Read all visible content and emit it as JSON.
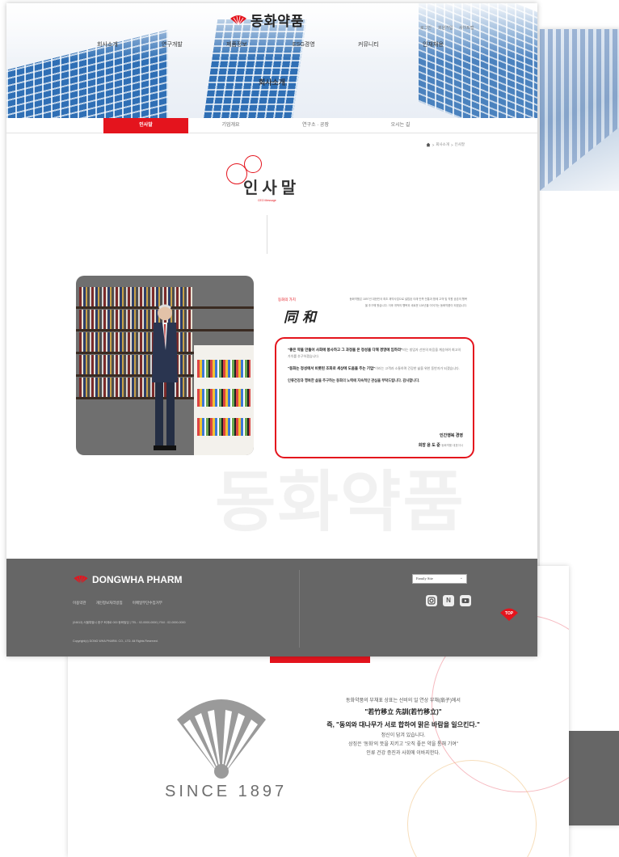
{
  "brand": {
    "name_kr": "동화약품",
    "name_en": "DONGWHA PHARM",
    "accent_color": "#e4141d",
    "footer_color": "#666666"
  },
  "header": {
    "util_links": [
      "로그인",
      "회원가입",
      "사이트맵"
    ],
    "gnb": [
      "회사소개",
      "연구개발",
      "제품정보",
      "ESG경영",
      "커뮤니티",
      "인재채용"
    ],
    "hero_title": "회사소개"
  },
  "subnav": {
    "items": [
      "인사말",
      "기업개요",
      "연구소 · 공장",
      "오시는 길"
    ],
    "active_index": 0
  },
  "breadcrumb": [
    "회사소개",
    "인사말"
  ],
  "page": {
    "title": "인사말",
    "subtitle": "CEO Message"
  },
  "motto": {
    "small_label": "동화의 가치",
    "hanja": "同和",
    "intro": "동화약품은 1897년 대한민국 최초 제약사업으로 설립된 이래 민족 전통과 함께 고객 및 직원 공존의 행복을 추구해 왔습니다. 이후 개척의 행복과 새로운 126년을 이어가는 동화약품이 되겠습니다."
  },
  "message": {
    "p1_bold": "\"좋은 약을 만들어 사회에 봉사하고 그 과정을 온 정성을 다해 경영에 임하라\"",
    "p1_rest": "라는 창업자 선친의 마음을 계승하여 최고의 가치를 추구하겠습니다.",
    "p2_bold": "\"동화는 정성에서 비롯된 조화로 세상에 도움을 주는 기업\"",
    "p2_rest": "이라는 고객과 소통하며 건강한 삶을 위한 동반자가 되겠습니다.",
    "p3": "인류건강과 행복한 삶을 추구하는 동화의 노력에 지속적인 관심을 부탁드립니다. 감사합니다.",
    "sign_line1": "인간행복 경영",
    "sign_name": "회장 윤 도 준",
    "sign_note": "동화약품 대표이사"
  },
  "watermark": "동화약품",
  "footer": {
    "links": [
      "이용약관",
      "개인정보처리방침",
      "이메일무단수집거부"
    ],
    "address": "(04613) 서울특별시 중구 퇴계로 000 동화빌딩 | TEL : 02-0000-0000 | FAX : 02-0000-0000",
    "copyright": "Copyright(c) DONG WHA PHARM. CO., LTD. All Rights Reserved.",
    "family_site": "Family Site",
    "sns": [
      "instagram",
      "naver-blog",
      "youtube"
    ],
    "top_label": "TOP"
  },
  "since": {
    "text": "SINCE 1897",
    "lines": [
      "동화약품의 부채표 상표는 선비의 일 연상 부채(扇子)에서",
      "\"若竹移立 先訓(若竹移立)\"",
      "즉, \"동의와 대나무가 서로 합하여 맑은 바람을 일으킨다.\"",
      "정신이 담겨 있습니다.",
      "상징은 '동화'의 뜻을 지키고 \"오직 좋은 약을 통해 기여\"",
      "인류 건강 증진과 사회에 이바지한다."
    ]
  }
}
